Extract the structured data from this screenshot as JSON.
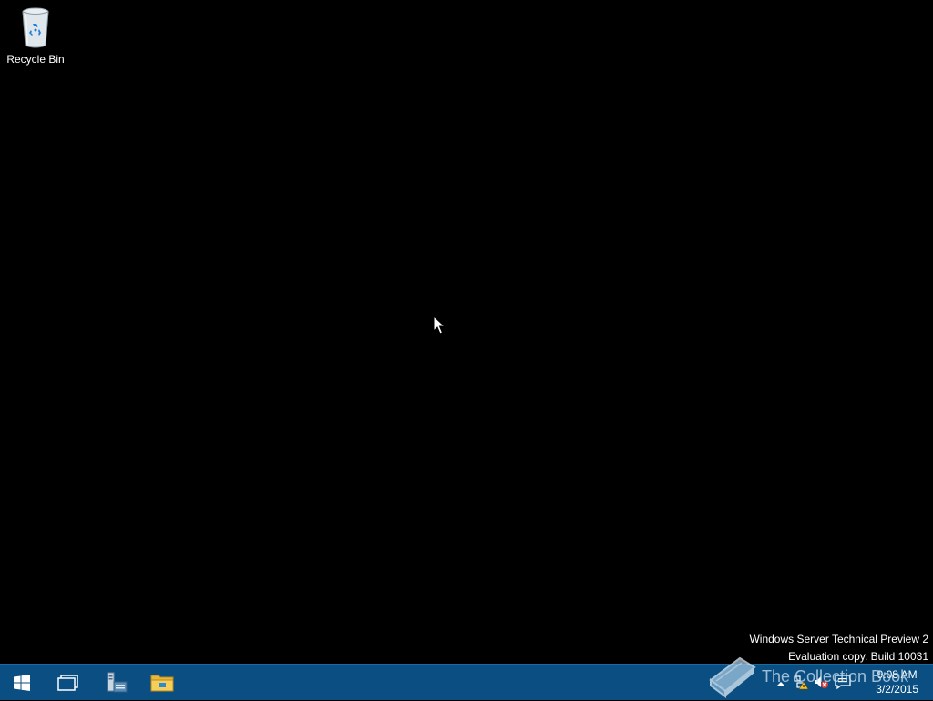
{
  "desktop": {
    "icons": [
      {
        "label": "Recycle Bin",
        "icon": "recycle-bin-icon"
      }
    ],
    "background_color": "#000000"
  },
  "watermark": {
    "line1": "Windows Server Technical Preview 2",
    "line2": "Evaluation copy. Build 10031"
  },
  "taskbar": {
    "color": "#0b4f82",
    "buttons": [
      {
        "id": "start",
        "icon": "windows-start-icon"
      },
      {
        "id": "task-view",
        "icon": "task-view-icon"
      },
      {
        "id": "server-manager",
        "icon": "server-manager-icon"
      },
      {
        "id": "file-explorer",
        "icon": "folder-icon"
      }
    ],
    "tray": {
      "icons": [
        "chevron-up-icon",
        "network-warning-icon",
        "volume-muted-icon",
        "action-center-icon"
      ],
      "time": "9:08 AM",
      "date": "3/2/2015"
    }
  },
  "overlay": {
    "logo_text": "The Collection Book"
  }
}
